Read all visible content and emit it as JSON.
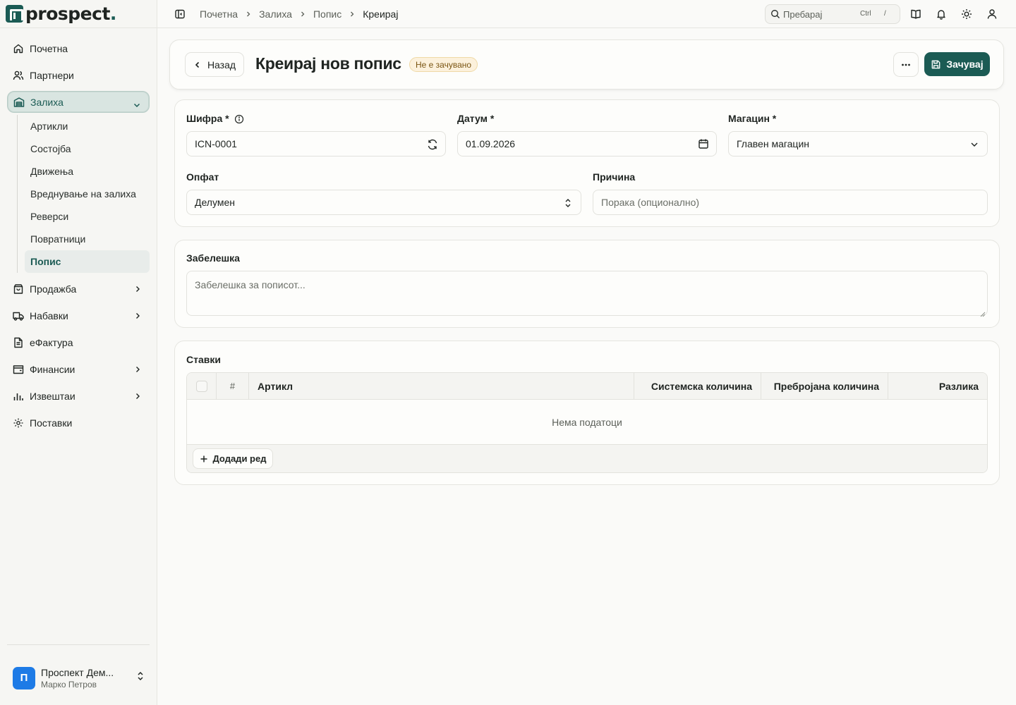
{
  "app": {
    "logo_text": "prospect",
    "logo_dot": "."
  },
  "sidebar": {
    "items": [
      {
        "label": "Почетна",
        "icon": "home-icon"
      },
      {
        "label": "Партнери",
        "icon": "users-icon"
      },
      {
        "label": "Залиха",
        "icon": "warehouse-icon",
        "expanded": true
      },
      {
        "label": "Продажба",
        "icon": "shopping-bag-icon"
      },
      {
        "label": "Набавки",
        "icon": "truck-icon"
      },
      {
        "label": "еФактура",
        "icon": "document-icon"
      },
      {
        "label": "Финансии",
        "icon": "wallet-icon"
      },
      {
        "label": "Извештаи",
        "icon": "bar-chart-icon"
      },
      {
        "label": "Поставки",
        "icon": "gear-icon"
      }
    ],
    "subitems": [
      "Артикли",
      "Состојба",
      "Движења",
      "Вреднување на залиха",
      "Реверси",
      "Повратници",
      "Попис"
    ],
    "active_subitem": "Попис",
    "user": {
      "initial": "П",
      "company": "Проспект Дем...",
      "name": "Марко Петров"
    }
  },
  "topbar": {
    "breadcrumb": [
      "Почетна",
      "Залиха",
      "Попис",
      "Креирај"
    ],
    "search_placeholder": "Пребарај",
    "search_kbd": "Ctrl",
    "search_key": "/"
  },
  "header": {
    "back_label": "Назад",
    "title": "Креирај нов попис",
    "status_badge": "Не е зачувано",
    "save_label": "Зачувај"
  },
  "form": {
    "code_label": "Шифра *",
    "code_value": "ICN-0001",
    "date_label": "Датум *",
    "date_value": "01.09.2026",
    "warehouse_label": "Магацин *",
    "warehouse_value": "Главен магацин",
    "scope_label": "Опфат",
    "scope_value": "Делумен",
    "reason_label": "Причина",
    "reason_placeholder": "Порака (опционално)"
  },
  "note": {
    "label": "Забелешка",
    "placeholder": "Забелешка за пописот..."
  },
  "items": {
    "label": "Ставки",
    "columns": [
      "#",
      "Артикл",
      "Системска количина",
      "Преброjана количина",
      "Разлика"
    ],
    "empty_text": "Нема податоци",
    "add_row_label": "Додади ред"
  },
  "colors": {
    "accent": "#1b5b54",
    "badge_bg": "#fcf1dc",
    "badge_text": "#7a5512",
    "avatar": "#1e7be6"
  }
}
